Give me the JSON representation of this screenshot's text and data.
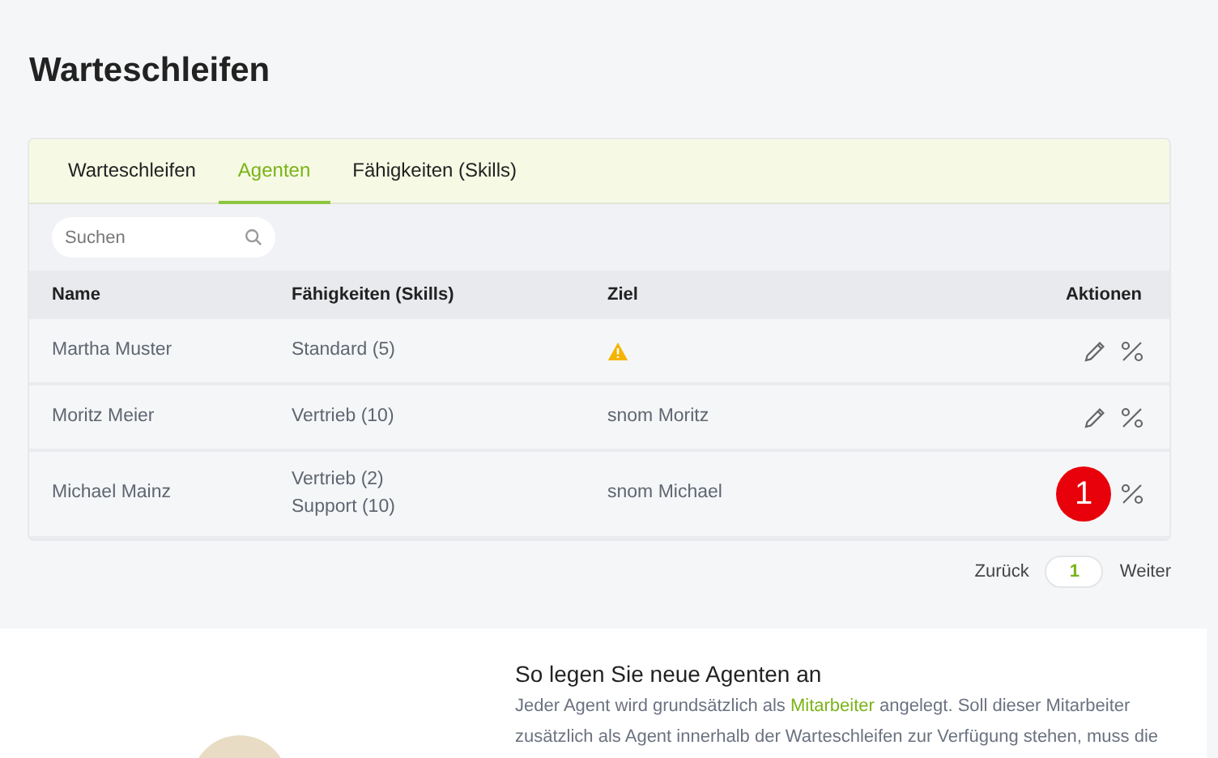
{
  "page_title": "Warteschleifen",
  "tabs": [
    {
      "label": "Warteschleifen",
      "selected": false
    },
    {
      "label": "Agenten",
      "selected": true
    },
    {
      "label": "Fähigkeiten (Skills)",
      "selected": false
    }
  ],
  "search": {
    "placeholder": "Suchen"
  },
  "table": {
    "columns": [
      "Name",
      "Fähigkeiten (Skills)",
      "Ziel",
      "Aktionen"
    ],
    "rows": [
      {
        "name": "Martha Muster",
        "skills": [
          "Standard (5)"
        ],
        "target_warning": true
      },
      {
        "name": "Moritz Meier",
        "skills": [
          "Vertrieb (10)"
        ],
        "target": "snom Moritz",
        "target_warning": false
      },
      {
        "name": "Michael Mainz",
        "skills": [
          "Vertrieb (2)",
          "Support (10)"
        ],
        "target": "snom Michael",
        "target_warning": false,
        "badge": "1"
      }
    ]
  },
  "pagination": {
    "prev": "Zurück",
    "page": "1",
    "next": "Weiter"
  },
  "help": {
    "heading": "So legen Sie neue Agenten an",
    "text_before": "Jeder Agent wird grundsätzlich als ",
    "link": "Mitarbeiter",
    "text_after": " angelegt. Soll dieser Mitarbeiter zusätzlich als Agent innerhalb der Warteschleifen zur Verfügung stehen, muss die"
  }
}
